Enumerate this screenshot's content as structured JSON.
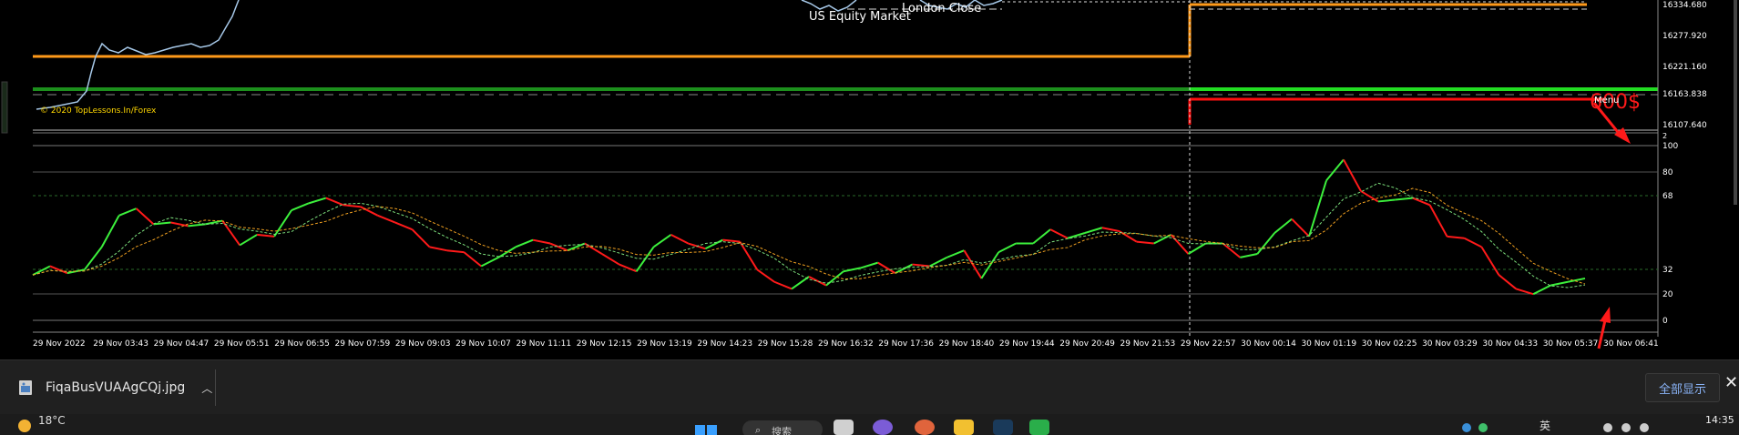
{
  "chart": {
    "watermark": "© 2020 TopLessons.In/Forex",
    "session_labels": [
      "US Equity Market",
      "London Close"
    ],
    "annotation": "600$",
    "label_menu": "Menu",
    "price_ticks": [
      "16334.680",
      "16277.920",
      "16221.160",
      "16163.838",
      "16107.640"
    ],
    "indicator_ticks": [
      "100",
      "80",
      "68",
      "32",
      "20",
      "0"
    ],
    "indicator_small_labels": [
      "2"
    ],
    "time_labels": [
      "29 Nov 2022",
      "29 Nov 03:43",
      "29 Nov 04:47",
      "29 Nov 05:51",
      "29 Nov 06:55",
      "29 Nov 07:59",
      "29 Nov 09:03",
      "29 Nov 10:07",
      "29 Nov 11:11",
      "29 Nov 12:15",
      "29 Nov 13:19",
      "29 Nov 14:23",
      "29 Nov 15:28",
      "29 Nov 16:32",
      "29 Nov 17:36",
      "29 Nov 18:40",
      "29 Nov 19:44",
      "29 Nov 20:49",
      "29 Nov 21:53",
      "29 Nov 22:57",
      "30 Nov 00:14",
      "30 Nov 01:19",
      "30 Nov 02:25",
      "30 Nov 03:29",
      "30 Nov 04:33",
      "30 Nov 05:37",
      "30 Nov 06:41"
    ],
    "colors": {
      "background": "#000000",
      "orange_level": "#ff9a1a",
      "green_level": "#22cc22",
      "red_level": "#ff1010",
      "indicator_up": "#3cf03c",
      "indicator_down": "#ff1a1a",
      "signal_green": "#7de07d",
      "signal_orange": "#f0a020",
      "price_candles": "#a6c8e8",
      "text": "#ffffff",
      "watermark": "#ffd700",
      "arrow": "#ff1a1a"
    },
    "indicator_series": {
      "x_scale_note": "values in oscillator units 0-100",
      "values": [
        26,
        31,
        27,
        29,
        42,
        60,
        64,
        55,
        56,
        54,
        55,
        57,
        43,
        49,
        48,
        63,
        67,
        70,
        66,
        65,
        60,
        56,
        52,
        42,
        40,
        39,
        31,
        36,
        42,
        46,
        44,
        40,
        44,
        38,
        32,
        28,
        42,
        49,
        44,
        41,
        46,
        45,
        29,
        22,
        18,
        25,
        20,
        28,
        30,
        33,
        27,
        32,
        31,
        36,
        40,
        24,
        39,
        44,
        44,
        52,
        47,
        50,
        53,
        51,
        45,
        44,
        49,
        38,
        44,
        44,
        36,
        38,
        50,
        58,
        48,
        80,
        92,
        74,
        68,
        69,
        70,
        66,
        48,
        47,
        42,
        26,
        18,
        15,
        20,
        22,
        24
      ]
    }
  },
  "downloads": {
    "file_name": "FiqaBusVUAAgCQj.jpg",
    "show_all": "全部显示",
    "close": "✕"
  },
  "taskbar": {
    "temperature": "18°C",
    "search_text": "搜索",
    "clock": "14:35",
    "ime": "英"
  }
}
